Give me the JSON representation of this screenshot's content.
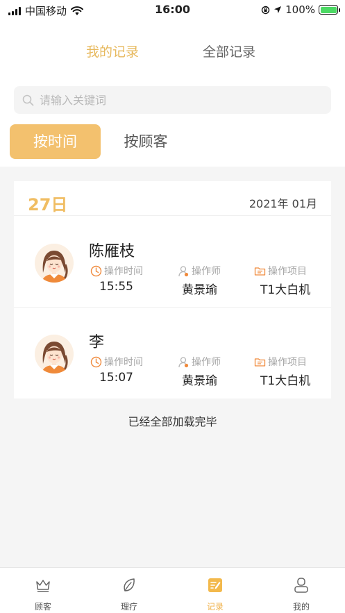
{
  "status_bar": {
    "carrier": "中国移动",
    "time": "16:00",
    "battery": "100%"
  },
  "tabs": [
    {
      "label": "我的记录",
      "active": true
    },
    {
      "label": "全部记录",
      "active": false
    }
  ],
  "search": {
    "placeholder": "请输入关键词",
    "value": ""
  },
  "filters": [
    {
      "label": "按时间",
      "active": true
    },
    {
      "label": "按顾客",
      "active": false
    }
  ],
  "group": {
    "day": "27日",
    "month": "2021年 01月"
  },
  "field_labels": {
    "time": "操作时间",
    "operator": "操作师",
    "project": "操作项目"
  },
  "records": [
    {
      "name": "陈雁枝",
      "time": "15:55",
      "operator": "黄景瑜",
      "project": "T1大白机"
    },
    {
      "name": "李",
      "time": "15:07",
      "operator": "黄景瑜",
      "project": "T1大白机"
    }
  ],
  "footer_text": "已经全部加载完毕",
  "tabbar": [
    {
      "label": "顾客",
      "icon": "crown-icon",
      "active": false
    },
    {
      "label": "理疗",
      "icon": "leaf-icon",
      "active": false
    },
    {
      "label": "记录",
      "icon": "notes-icon",
      "active": true
    },
    {
      "label": "我的",
      "icon": "user-icon",
      "active": false
    }
  ],
  "colors": {
    "accent": "#f3c16e",
    "accent_text": "#e7b95e",
    "day_text": "#f0bd62",
    "icon_orange": "#f08a3c"
  }
}
